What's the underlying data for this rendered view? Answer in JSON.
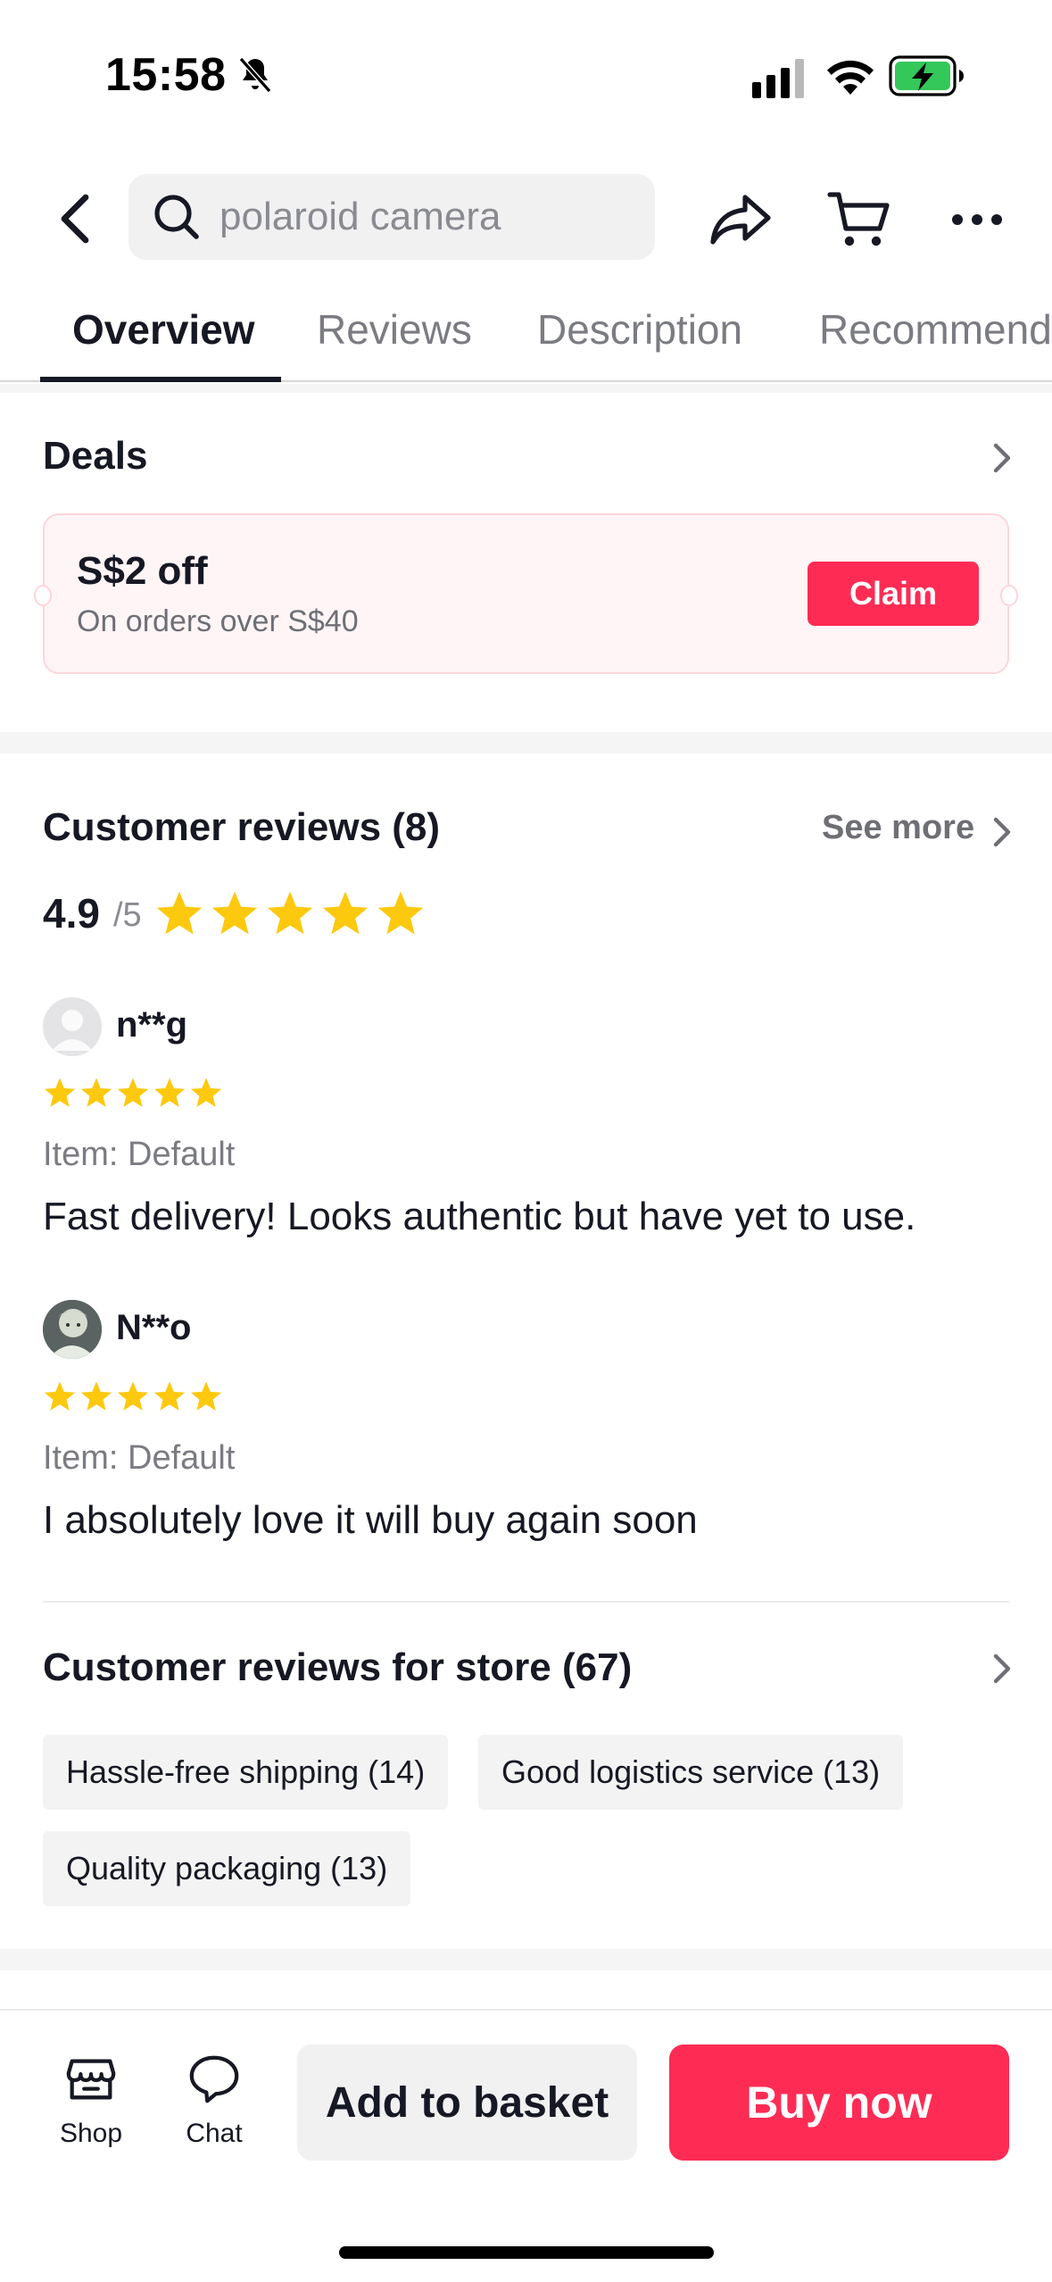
{
  "status_bar": {
    "time": "15:58"
  },
  "header": {
    "search_text": "polaroid camera"
  },
  "tabs": [
    {
      "label": "Overview",
      "active": true
    },
    {
      "label": "Reviews"
    },
    {
      "label": "Description"
    },
    {
      "label": "Recommend"
    }
  ],
  "deals": {
    "title": "Deals",
    "coupon": {
      "title": "S$2 off",
      "subtitle": "On orders over S$40",
      "claim_label": "Claim"
    }
  },
  "reviews": {
    "title": "Customer reviews (8)",
    "see_more": "See more",
    "rating": "4.9",
    "rating_suffix": "/5",
    "stars": 5,
    "items": [
      {
        "user": "n**g",
        "stars": 5,
        "item": "Item: Default",
        "text": "Fast delivery! Looks authentic but have yet to use."
      },
      {
        "user": "N**o",
        "stars": 5,
        "item": "Item: Default",
        "text": "I absolutely love it will buy again soon"
      }
    ]
  },
  "store_reviews": {
    "title": "Customer reviews for store (67)",
    "chips": [
      "Hassle-free shipping (14)",
      "Good logistics service (13)",
      "Quality packaging (13)"
    ]
  },
  "bottom_bar": {
    "shop_label": "Shop",
    "chat_label": "Chat",
    "basket_label": "Add to basket",
    "buy_label": "Buy now"
  },
  "colors": {
    "accent": "#fe2c55",
    "star": "#fdc90f",
    "battery": "#34c759"
  }
}
